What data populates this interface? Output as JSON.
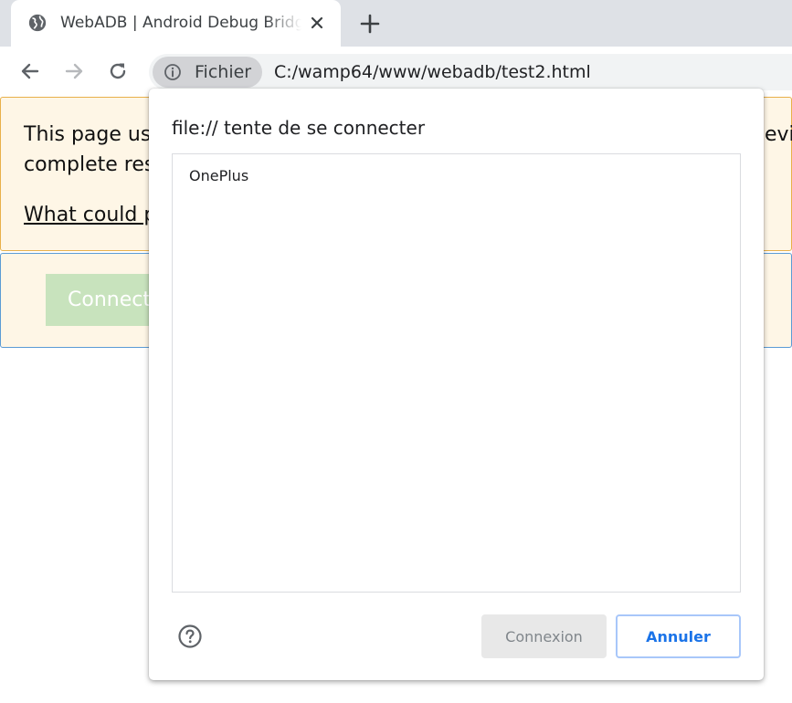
{
  "browser": {
    "tab": {
      "title": "WebADB | Android Debug Bridge",
      "icon": "globe-icon",
      "close_icon": "close-icon"
    },
    "new_tab_icon": "plus-icon",
    "toolbar": {
      "back_icon": "arrow-left-icon",
      "forward_icon": "arrow-right-icon",
      "reload_icon": "reload-icon",
      "site_info": {
        "icon": "info-icon",
        "label": "Fichier"
      },
      "url": "C:/wamp64/www/webadb/test2.html"
    }
  },
  "page": {
    "warning": {
      "line1": "This page us",
      "line1_right": "evic",
      "line2": "complete res",
      "link": "What could p"
    },
    "connect_button_label": "Connect"
  },
  "dialog": {
    "title": "file:// tente de se connecter",
    "devices": [
      "OnePlus"
    ],
    "help_icon": "help-circle-icon",
    "connect_label": "Connexion",
    "cancel_label": "Annuler"
  },
  "colors": {
    "tabstrip_bg": "#dee1e6",
    "omnibox_bg": "#f1f3f4",
    "warning_bg": "#fef6e6",
    "warning_border": "#e8b04a",
    "panel_border": "#5b9bd5",
    "connect_disabled_bg": "#c8e3bd",
    "accent": "#1a73e8"
  }
}
